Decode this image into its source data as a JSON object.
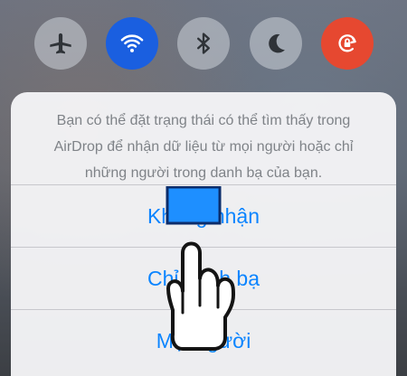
{
  "quick_toggles": [
    {
      "name": "airplane-mode",
      "icon": "airplane-icon",
      "state": "off"
    },
    {
      "name": "wifi",
      "icon": "wifi-icon",
      "state": "on"
    },
    {
      "name": "bluetooth",
      "icon": "bluetooth-icon",
      "state": "off"
    },
    {
      "name": "do-not-disturb",
      "icon": "moon-icon",
      "state": "off"
    },
    {
      "name": "rotation-lock",
      "icon": "rotation-lock-icon",
      "state": "on"
    }
  ],
  "airdrop_sheet": {
    "message": "Bạn có thể đặt trạng thái có thể tìm thấy trong AirDrop để nhận dữ liệu từ mọi người hoặc chỉ những người trong danh bạ của bạn.",
    "options": [
      {
        "label": "Không nhận"
      },
      {
        "label": "Chỉ danh bạ"
      },
      {
        "label": "Mọi người"
      }
    ]
  },
  "colors": {
    "accent": "#0a84ff",
    "wifi_active": "#1a5fe0",
    "rotation_lock_active": "#e64830",
    "highlight_box": "#1e8fff"
  },
  "overlay": {
    "pointer_icon": "tap-hand-icon"
  }
}
